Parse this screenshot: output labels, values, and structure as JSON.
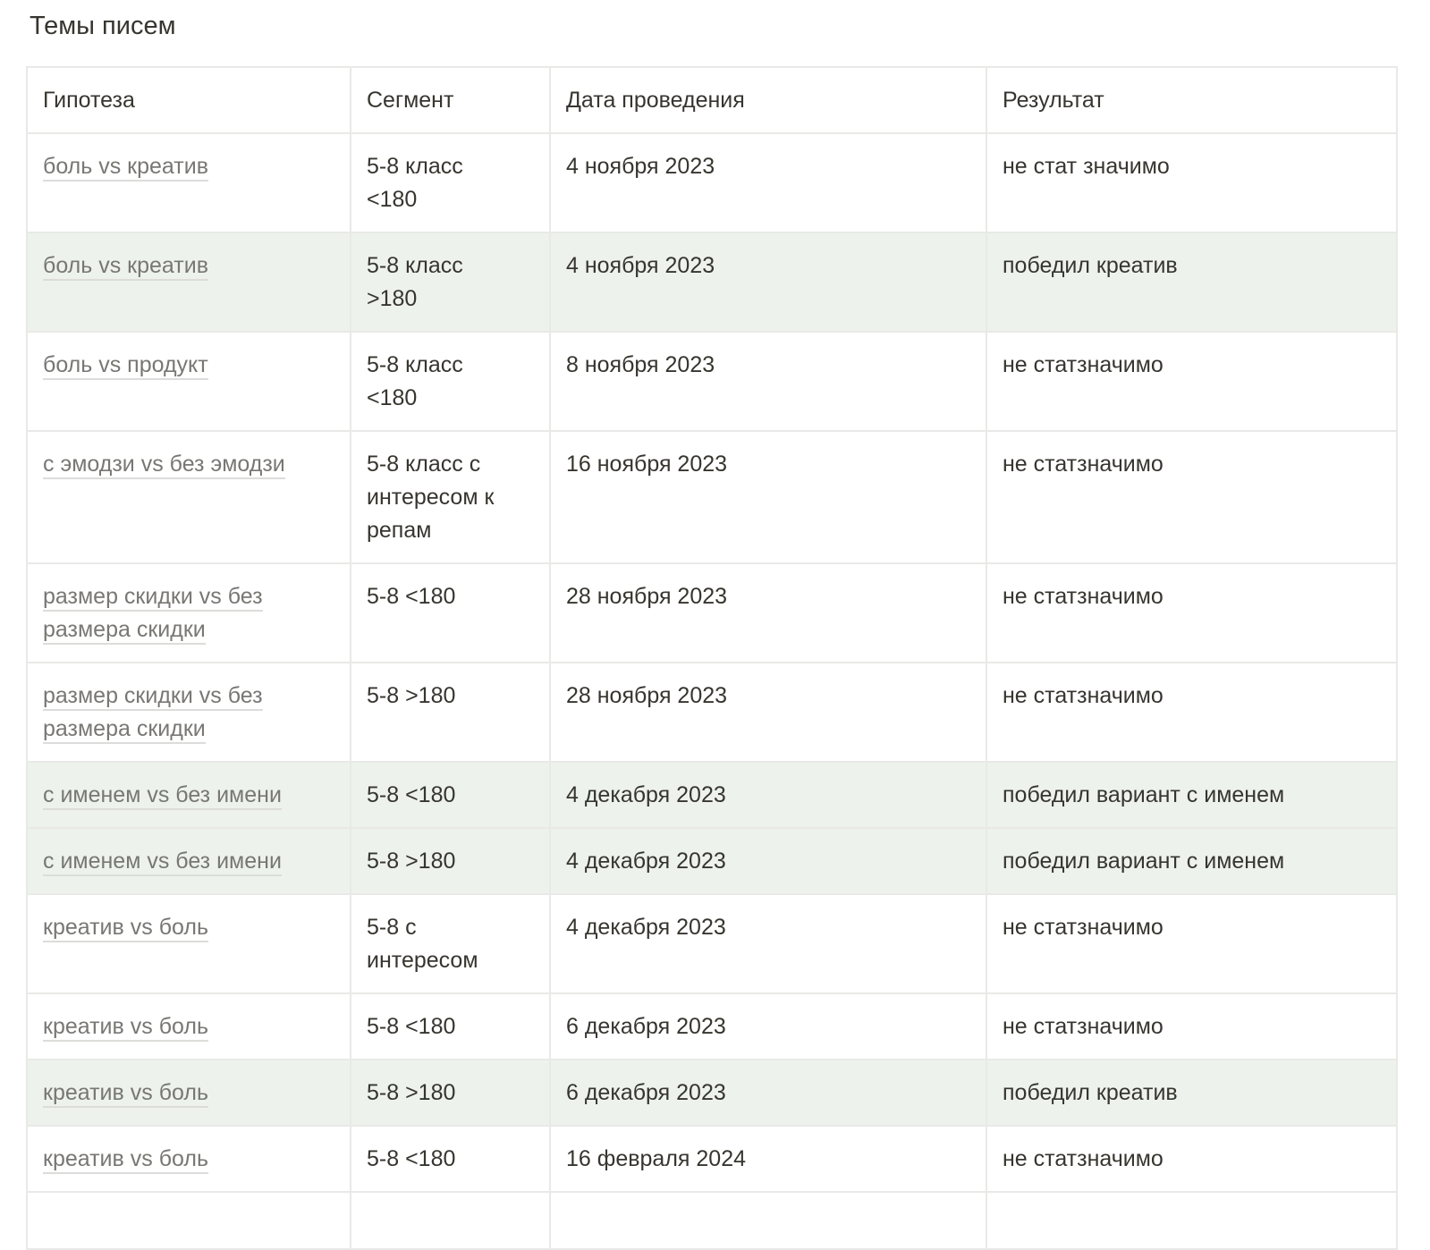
{
  "page": {
    "title": "Темы писем"
  },
  "table": {
    "columns": [
      "Гипотеза",
      "Сегмент",
      "Дата проведения",
      "Результат"
    ],
    "rows": [
      {
        "hypothesis": "боль vs креатив",
        "segment": "5-8 класс\n<180",
        "date": "4 ноября 2023",
        "result": "не стат значимо"
      },
      {
        "hypothesis": "боль vs креатив",
        "segment": "5-8 класс\n>180",
        "date": "4 ноября 2023",
        "result": "победил креатив"
      },
      {
        "hypothesis": "боль vs продукт",
        "segment": "5-8 класс\n<180",
        "date": "8 ноября 2023",
        "result": "не статзначимо"
      },
      {
        "hypothesis": "с эмодзи vs без эмодзи",
        "segment": "5-8 класс с\nинтересом к\nрепам",
        "date": "16 ноября 2023",
        "result": "не статзначимо"
      },
      {
        "hypothesis": "размер скидки vs без\nразмера скидки",
        "segment": "5-8 <180",
        "date": "28 ноября 2023",
        "result": "не статзначимо"
      },
      {
        "hypothesis": "размер скидки vs без\nразмера скидки",
        "segment": "5-8 >180",
        "date": "28 ноября 2023",
        "result": "не статзначимо"
      },
      {
        "hypothesis": "с именем vs без имени",
        "segment": "5-8 <180",
        "date": "4 декабря 2023",
        "result": "победил вариант с именем"
      },
      {
        "hypothesis": "с именем vs без имени",
        "segment": "5-8 >180",
        "date": "4 декабря 2023",
        "result": "победил вариант с именем"
      },
      {
        "hypothesis": "креатив vs боль",
        "segment": "5-8 с\nинтересом",
        "date": "4 декабря 2023",
        "result": "не статзначимо"
      },
      {
        "hypothesis": "креатив vs боль",
        "segment": "5-8 <180",
        "date": "6 декабря 2023",
        "result": "не статзначимо"
      },
      {
        "hypothesis": "креатив vs боль",
        "segment": "5-8 >180",
        "date": "6 декабря 2023",
        "result": "победил креатив"
      },
      {
        "hypothesis": "креатив vs боль",
        "segment": "5-8 <180",
        "date": "16 февраля 2024",
        "result": "не статзначимо"
      },
      {
        "hypothesis": "",
        "segment": "",
        "date": "",
        "result": ""
      }
    ]
  },
  "colors": {
    "text": "#37352f",
    "link_text": "#787774",
    "border": "#e9e9e7",
    "highlight_row": "#edf3ec"
  }
}
